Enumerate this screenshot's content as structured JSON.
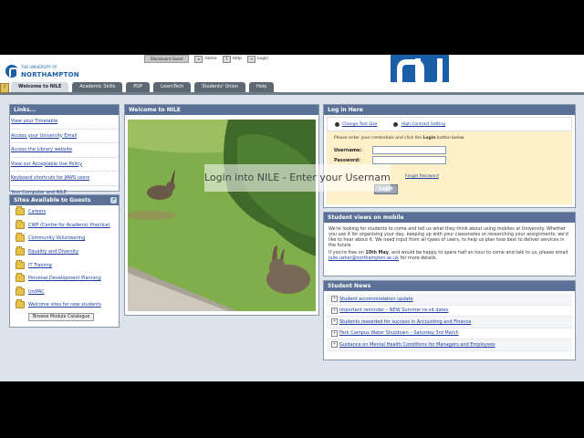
{
  "header": {
    "logo_small": "THE UNIVERSITY OF",
    "logo_big": "NORTHAMPTON",
    "guest_label": "Blackboard Guest",
    "links": [
      {
        "label": "Home",
        "icon": "home-icon",
        "glyph": "⌂"
      },
      {
        "label": "Help",
        "icon": "help-icon",
        "glyph": "?"
      },
      {
        "label": "Login",
        "icon": "login-icon",
        "glyph": "→"
      }
    ]
  },
  "tabs": [
    {
      "label": "Welcome to NILE",
      "active": true
    },
    {
      "label": "Academic Skills",
      "active": false
    },
    {
      "label": "PDP",
      "active": false
    },
    {
      "label": "LearnTech",
      "active": false
    },
    {
      "label": "Students' Union",
      "active": false
    },
    {
      "label": "Help",
      "active": false
    }
  ],
  "links_panel": {
    "title": "Links...",
    "items": [
      "View your Timetable",
      "Access your University Email",
      "Access the Library website",
      "View our Acceptable Use Policy",
      "Keyboard shortcuts for JAWS users",
      "Your Computer and NILE"
    ]
  },
  "sites_panel": {
    "title": "Sites Available to Guests",
    "items": [
      "Careers",
      "CWP (Centre for Academic Practice)",
      "Community Volunteering",
      "Equality and Diversity",
      "IT Training",
      "Personal Development Planning",
      "UniPAC",
      "Welcome sites for new students"
    ],
    "browse_label": "Browse Module Catalogue"
  },
  "welcome_panel": {
    "title": "Welcome to NILE"
  },
  "login_panel": {
    "title": "Log in Here",
    "option1": "Change Text Size",
    "option2": "High Contrast Setting",
    "instructions_a": "Please enter your credentials and click the ",
    "instructions_b": "Login",
    "instructions_c": " button below.",
    "username_label": "Username:",
    "password_label": "Password:",
    "forgot": "Forgot Password",
    "login_button": "Login"
  },
  "views_panel": {
    "title": "Student views on mobile",
    "para1": "We're looking for students to come and tell us what they think about using mobiles at University. Whether you use it for organising your day, keeping up with your classmates or researching your assignments, we'd like to hear about it. We need input from all types of users, to help us plan how best to deliver services in the future.",
    "para2_a": "If you're free on ",
    "para2_b": "10th May",
    "para2_c": ", and would be happy to spare half an hour to come and talk to us, please email ",
    "para2_email": "julie.usher@northampton.ac.uk",
    "para2_d": " for more details."
  },
  "news_panel": {
    "title": "Student News",
    "items": [
      "Student accommodation update",
      "Important reminder – NEW Summer re-sit dates",
      "Students rewarded for success in Accounting and Finance",
      "Park Campus Water Shutdown – Saturday 3rd March",
      "Guidance on Mental Health Conditions for Managers and Employees"
    ]
  },
  "overlay": {
    "caption": "Login into NILE - Enter your Username"
  }
}
